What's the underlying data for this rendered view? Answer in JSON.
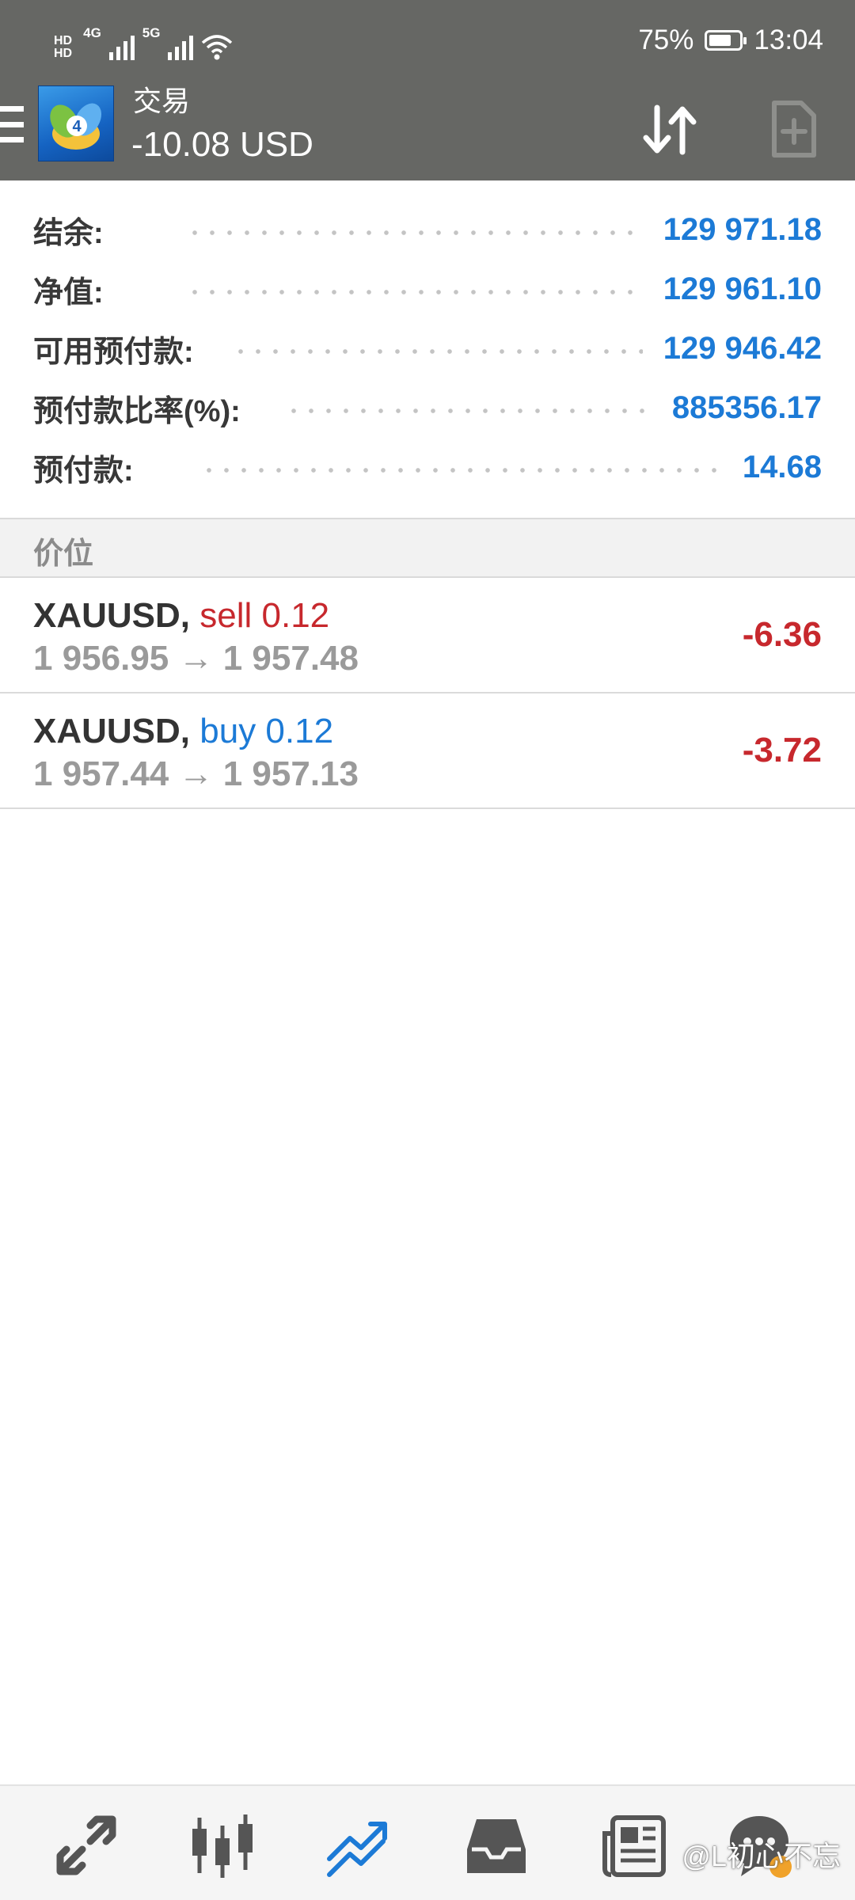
{
  "status_bar": {
    "hd_top": "HD",
    "hd_bottom": "HD",
    "network_1": "4G",
    "network_2": "5G",
    "battery": "75%",
    "battery_level": 0.75,
    "time": "13:04"
  },
  "toolbar": {
    "title": "交易",
    "profit": "-10.08 USD",
    "icons": [
      "menu-icon",
      "metatrader-logo",
      "sort-icon",
      "new-order-icon"
    ]
  },
  "summary": [
    {
      "label": "结余:",
      "value": "129 971.18"
    },
    {
      "label": "净值:",
      "value": "129 961.10"
    },
    {
      "label": "可用预付款:",
      "value": "129 946.42"
    },
    {
      "label": "预付款比率(%):",
      "value": "885356.17"
    },
    {
      "label": "预付款:",
      "value": "14.68"
    }
  ],
  "section_title": "价位",
  "positions": [
    {
      "symbol": "XAUUSD,",
      "type": "sell 0.12",
      "prices": "1 956.95 → 1 957.48",
      "profit": "-6.36"
    },
    {
      "symbol": "XAUUSD,",
      "type": "buy 0.12",
      "prices": "1 957.44 → 1 957.13",
      "profit": "-3.72"
    }
  ],
  "bottom_nav": {
    "items": [
      "quotes-icon",
      "chart-icon",
      "trade-icon",
      "history-icon",
      "news-icon",
      "messages-icon"
    ],
    "active": "trade-icon",
    "active_color": "#1c7ad6",
    "icon_color": "#555555"
  },
  "watermark": "@L初心不忘"
}
